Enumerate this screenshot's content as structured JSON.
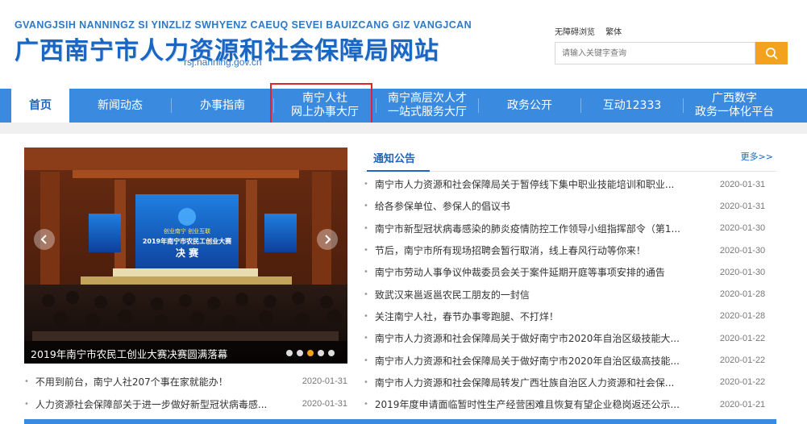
{
  "header": {
    "pinyin": "GVANGJSIH NANNINGZ SI YINZLIZ SWHYENZ CAEUQ SEVEI BAUIZCANG GIZ VANGJCAN",
    "title": "广西南宁市人力资源和社会保障局网站",
    "domain": "rsj.nanning.gov.cn",
    "accessibility_link": "无障碍浏览",
    "traditional_link": "繁体",
    "search_placeholder": "请输入关键字查询",
    "search_icon": "search-icon"
  },
  "colors": {
    "brand_blue": "#1a66c2",
    "nav_blue": "#3a8be0",
    "accent_orange": "#f3a21d",
    "highlight_red": "#e0242f"
  },
  "nav": {
    "items": [
      {
        "line1": "首页",
        "line2": ""
      },
      {
        "line1": "新闻动态",
        "line2": ""
      },
      {
        "line1": "办事指南",
        "line2": ""
      },
      {
        "line1": "南宁人社",
        "line2": "网上办事大厅"
      },
      {
        "line1": "南宁高层次人才",
        "line2": "一站式服务大厅"
      },
      {
        "line1": "政务公开",
        "line2": ""
      },
      {
        "line1": "互动12333",
        "line2": ""
      },
      {
        "line1": "广西数字",
        "line2": "政务一体化平台"
      }
    ],
    "active_index": 0
  },
  "banner": {
    "screen_text_1": "创业南宁 创业互联",
    "screen_text_2": "2019年南宁市农民工创业大赛",
    "screen_text_3": "决 赛",
    "caption": "2019年南宁市农民工创业大赛决赛圆满落幕",
    "dot_count": 5,
    "active_dot": 2
  },
  "left_news": [
    {
      "title": "不用到前台，南宁人社207个事在家就能办！",
      "date": "2020-01-31"
    },
    {
      "title": "人力资源社会保障部关于进一步做好新型冠状病毒感...",
      "date": "2020-01-31"
    }
  ],
  "notices": {
    "tab_label": "通知公告",
    "more_label": "更多>>",
    "items": [
      {
        "title": "南宁市人力资源和社会保障局关于暂停线下集中职业技能培训和职业...",
        "date": "2020-01-31"
      },
      {
        "title": "给各参保单位、参保人的倡议书",
        "date": "2020-01-31"
      },
      {
        "title": "南宁市新型冠状病毒感染的肺炎疫情防控工作领导小组指挥部令（第1...",
        "date": "2020-01-30"
      },
      {
        "title": "节后，南宁市所有现场招聘会暂行取消，线上春风行动等你来！",
        "date": "2020-01-30"
      },
      {
        "title": "南宁市劳动人事争议仲裁委员会关于案件延期开庭等事项安排的通告",
        "date": "2020-01-30"
      },
      {
        "title": "致武汉来邕返邕农民工朋友的一封信",
        "date": "2020-01-28"
      },
      {
        "title": "关注南宁人社，春节办事零跑腿、不打烊！",
        "date": "2020-01-28"
      },
      {
        "title": "南宁市人力资源和社会保障局关于做好南宁市2020年自治区级技能大...",
        "date": "2020-01-22"
      },
      {
        "title": "南宁市人力资源和社会保障局关于做好南宁市2020年自治区级高技能...",
        "date": "2020-01-22"
      },
      {
        "title": "南宁市人力资源和社会保障局转发广西壮族自治区人力资源和社会保...",
        "date": "2020-01-22"
      },
      {
        "title": "2019年度申请面临暂时性生产经营困难且恢复有望企业稳岗返还公示...",
        "date": "2020-01-21"
      }
    ]
  }
}
